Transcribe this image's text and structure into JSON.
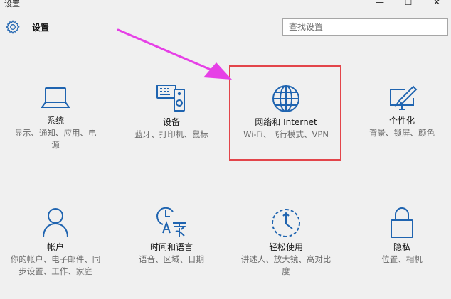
{
  "window": {
    "title": "设置",
    "controls": [
      "—",
      "☐",
      "✕"
    ]
  },
  "header": {
    "title": "设置"
  },
  "search": {
    "placeholder": "查找设置"
  },
  "tiles": [
    {
      "label": "系统",
      "desc": "显示、通知、应用、电源",
      "icon": "laptop-icon"
    },
    {
      "label": "设备",
      "desc": "蓝牙、打印机、鼠标",
      "icon": "devices-icon"
    },
    {
      "label": "网络和 Internet",
      "desc": "Wi-Fi、飞行模式、VPN",
      "icon": "globe-icon"
    },
    {
      "label": "个性化",
      "desc": "背景、锁屏、颜色",
      "icon": "personalization-icon"
    },
    {
      "label": "帐户",
      "desc": "你的帐户、电子邮件、同步设置、工作、家庭",
      "icon": "person-icon"
    },
    {
      "label": "时间和语言",
      "desc": "语音、区域、日期",
      "icon": "time-language-icon"
    },
    {
      "label": "轻松使用",
      "desc": "讲述人、放大镜、高对比度",
      "icon": "ease-of-access-icon"
    },
    {
      "label": "隐私",
      "desc": "位置、相机",
      "icon": "lock-icon"
    }
  ],
  "colors": {
    "accent": "#1f64b0",
    "highlight_border": "#e3454a",
    "arrow": "#e640e6"
  }
}
